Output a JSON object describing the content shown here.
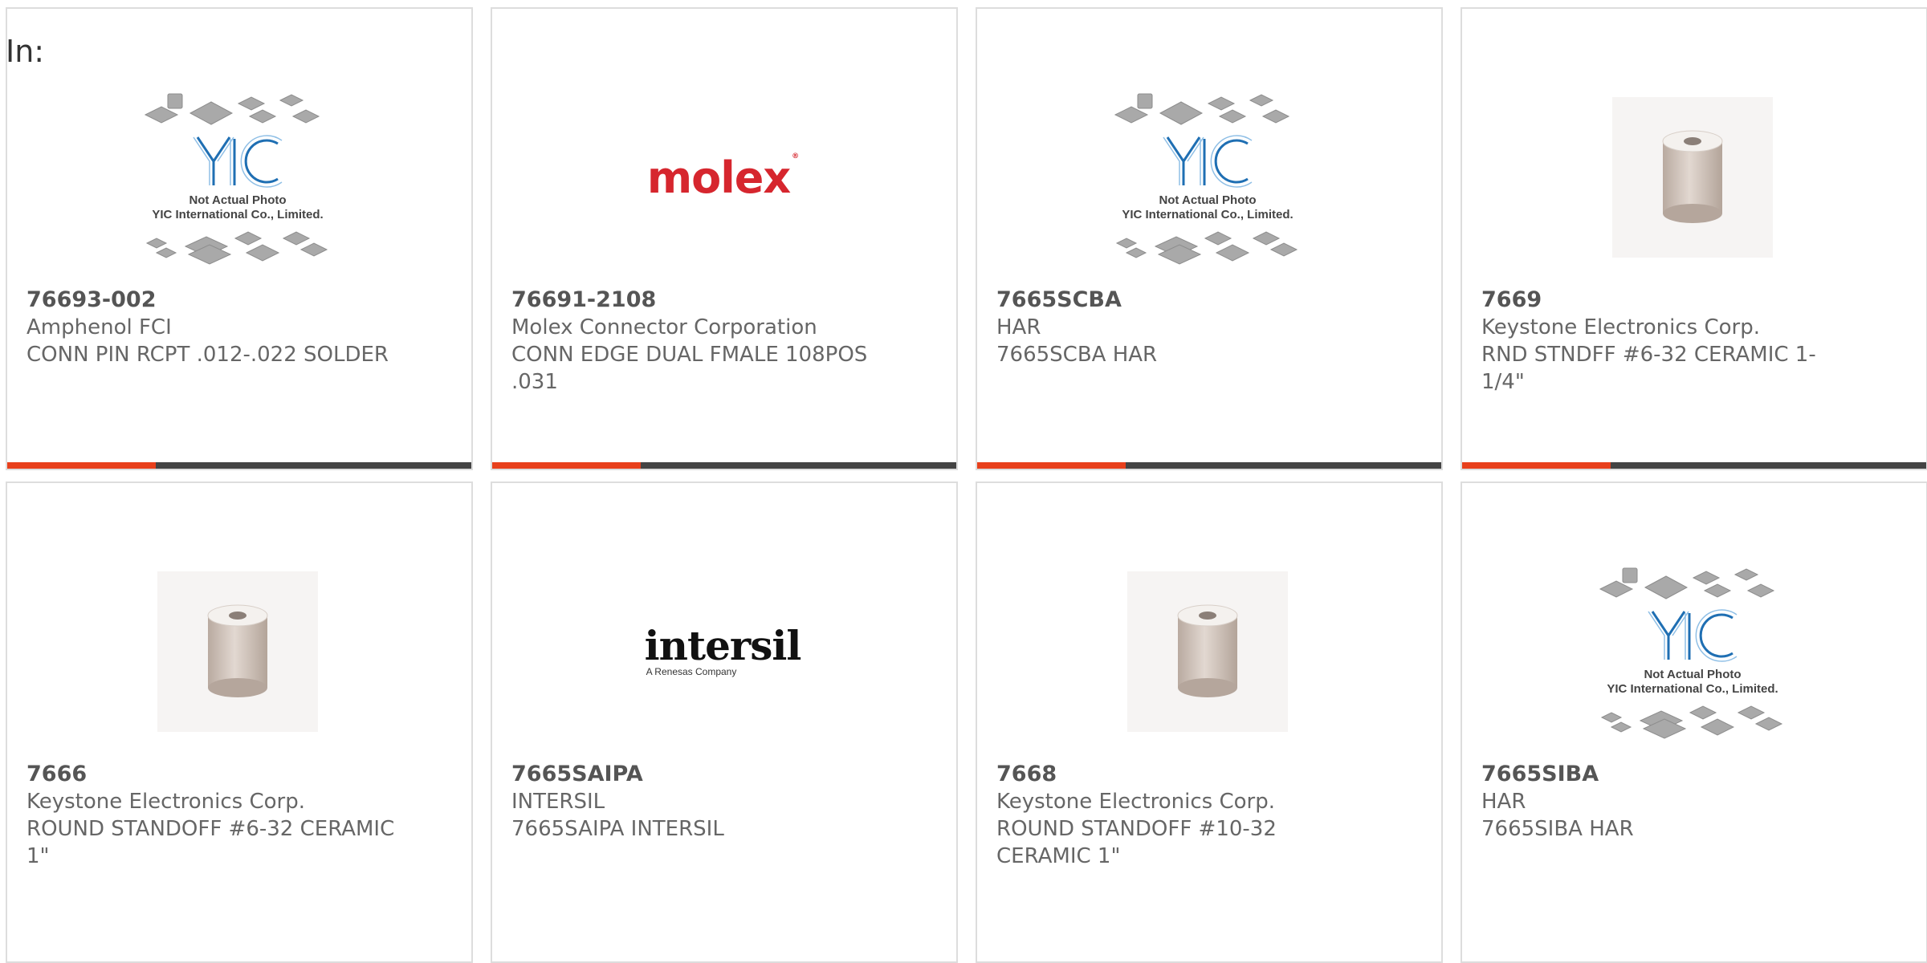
{
  "page": {
    "label": "In:",
    "accent_color": "#e8401c",
    "track_color": "#444444",
    "card_border_color": "#dddddd"
  },
  "products": [
    {
      "part_number": "76693-002",
      "manufacturer": "Amphenol FCI",
      "description": "CONN PIN RCPT .012-.022 SOLDER",
      "image": {
        "type": "yic-placeholder",
        "line1": "Not Actual Photo",
        "line2": "YIC International Co., Limited.",
        "logo": "YIC"
      },
      "progress": 0.32
    },
    {
      "part_number": "76691-2108",
      "manufacturer": "Molex Connector Corporation",
      "description": "CONN EDGE DUAL FMALE 108POS .031",
      "image": {
        "type": "brand-logo",
        "logo_text": "molex",
        "logo_mark": "®",
        "color": "#d6262e"
      },
      "progress": 0.32
    },
    {
      "part_number": "7665SCBA",
      "manufacturer": "HAR",
      "description": "7665SCBA HAR",
      "image": {
        "type": "yic-placeholder",
        "line1": "Not Actual Photo",
        "line2": "YIC International Co., Limited.",
        "logo": "YIC"
      },
      "progress": 0.32
    },
    {
      "part_number": "7669",
      "manufacturer": "Keystone Electronics Corp.",
      "description": "RND STNDFF #6-32 CERAMIC 1-1/4\"",
      "image": {
        "type": "photo",
        "subject": "ceramic-standoff"
      },
      "progress": 0.32
    },
    {
      "part_number": "7666",
      "manufacturer": "Keystone Electronics Corp.",
      "description": "ROUND STANDOFF #6-32 CERAMIC 1\"",
      "image": {
        "type": "photo",
        "subject": "ceramic-standoff"
      },
      "progress": null
    },
    {
      "part_number": "7665SAIPA",
      "manufacturer": "INTERSIL",
      "description": "7665SAIPA INTERSIL",
      "image": {
        "type": "brand-logo",
        "logo_text": "intersil",
        "logo_sub": "A Renesas Company",
        "color": "#111111"
      },
      "progress": null
    },
    {
      "part_number": "7668",
      "manufacturer": "Keystone Electronics Corp.",
      "description": "ROUND STANDOFF #10-32 CERAMIC 1\"",
      "image": {
        "type": "photo",
        "subject": "ceramic-standoff"
      },
      "progress": null
    },
    {
      "part_number": "7665SIBA",
      "manufacturer": "HAR",
      "description": "7665SIBA HAR",
      "image": {
        "type": "yic-placeholder",
        "line1": "Not Actual Photo",
        "line2": "YIC International Co., Limited.",
        "logo": "YIC"
      },
      "progress": null
    }
  ]
}
